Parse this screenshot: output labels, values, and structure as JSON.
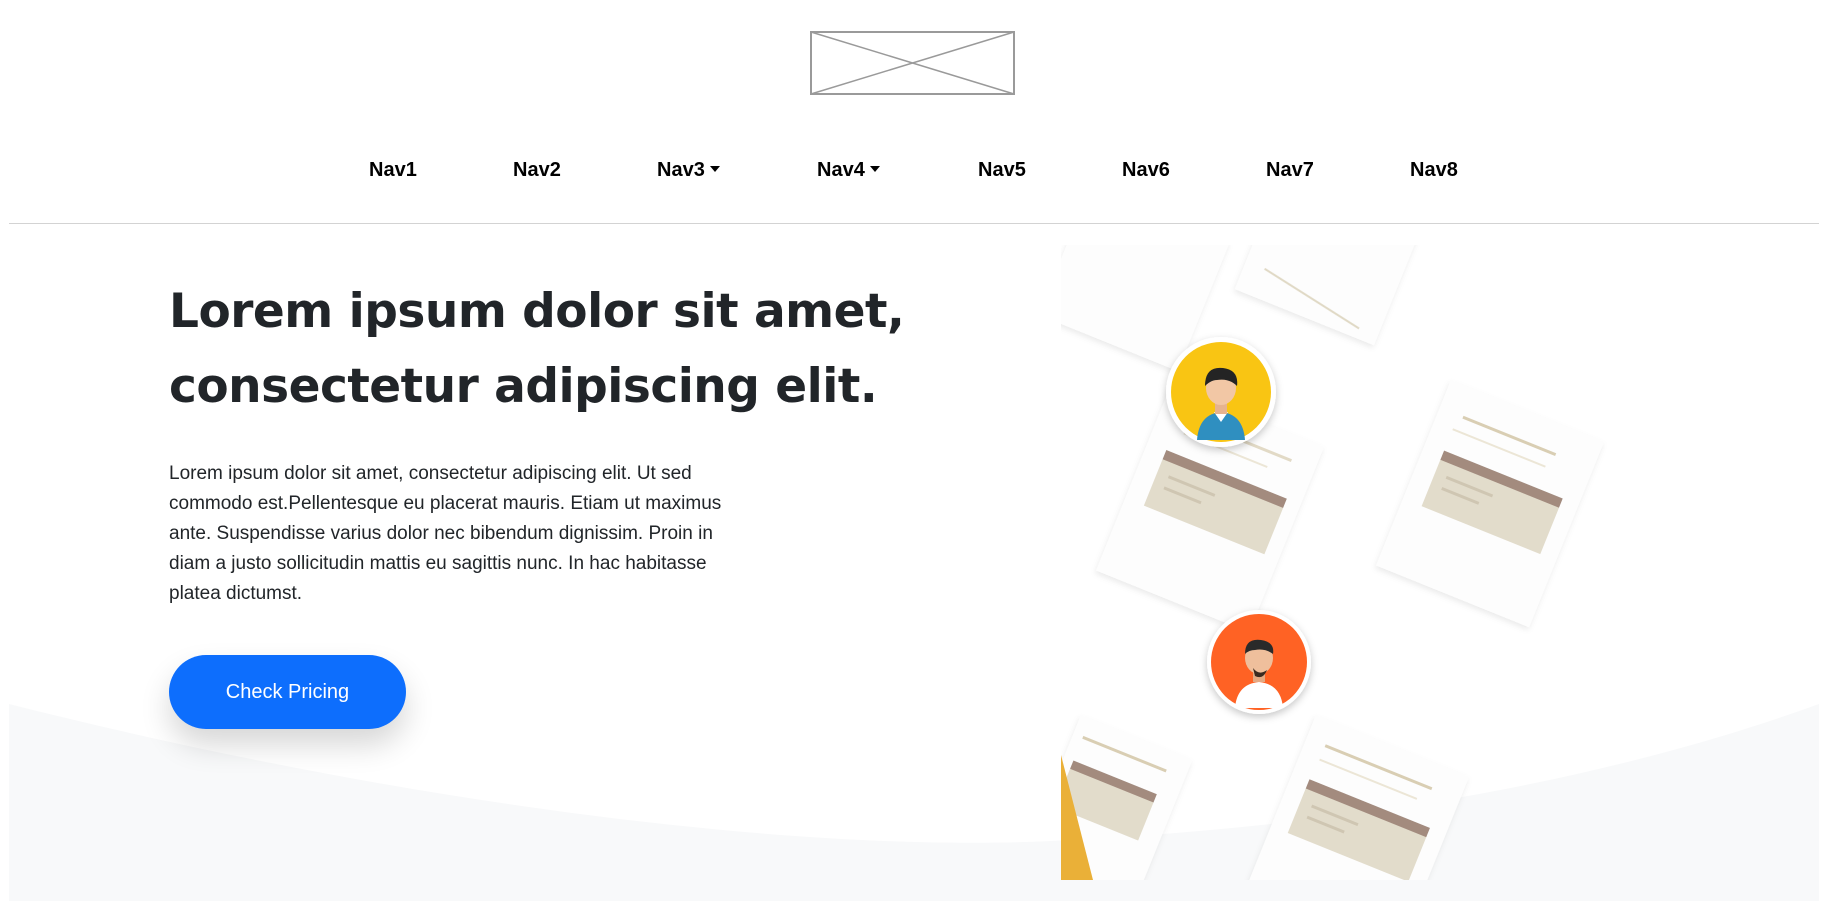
{
  "header": {
    "logo_alt": "logo placeholder"
  },
  "nav": {
    "items": [
      {
        "label": "Nav1",
        "dropdown": false
      },
      {
        "label": "Nav2",
        "dropdown": false
      },
      {
        "label": "Nav3",
        "dropdown": true
      },
      {
        "label": "Nav4",
        "dropdown": true
      },
      {
        "label": "Nav5",
        "dropdown": false
      },
      {
        "label": "Nav6",
        "dropdown": false
      },
      {
        "label": "Nav7",
        "dropdown": false
      },
      {
        "label": "Nav8",
        "dropdown": false
      }
    ]
  },
  "hero": {
    "title": "Lorem ipsum dolor sit amet, consectetur adipiscing elit.",
    "body": "Lorem ipsum dolor sit amet, consectetur adipiscing elit. Ut sed commodo est.Pellentesque eu placerat mauris. Etiam ut maximus ante. Suspendisse varius dolor nec bibendum dignissim. Proin in diam a justo sollicitudin mattis eu sagittis nunc. In hac habitasse platea dictumst.",
    "cta_label": "Check Pricing"
  },
  "colors": {
    "primary": "#0d6efd",
    "heading": "#212529",
    "wave_background": "#f8f9fa",
    "avatar_yellow": "#f9c513",
    "avatar_orange": "#ff6224",
    "card_beige": "#e2dccb",
    "card_band": "#a38b7e"
  },
  "icons": {
    "logo": "image-placeholder-icon",
    "dropdown": "caret-down-icon",
    "avatar_1": "user-avatar-icon",
    "avatar_2": "user-avatar-icon"
  }
}
